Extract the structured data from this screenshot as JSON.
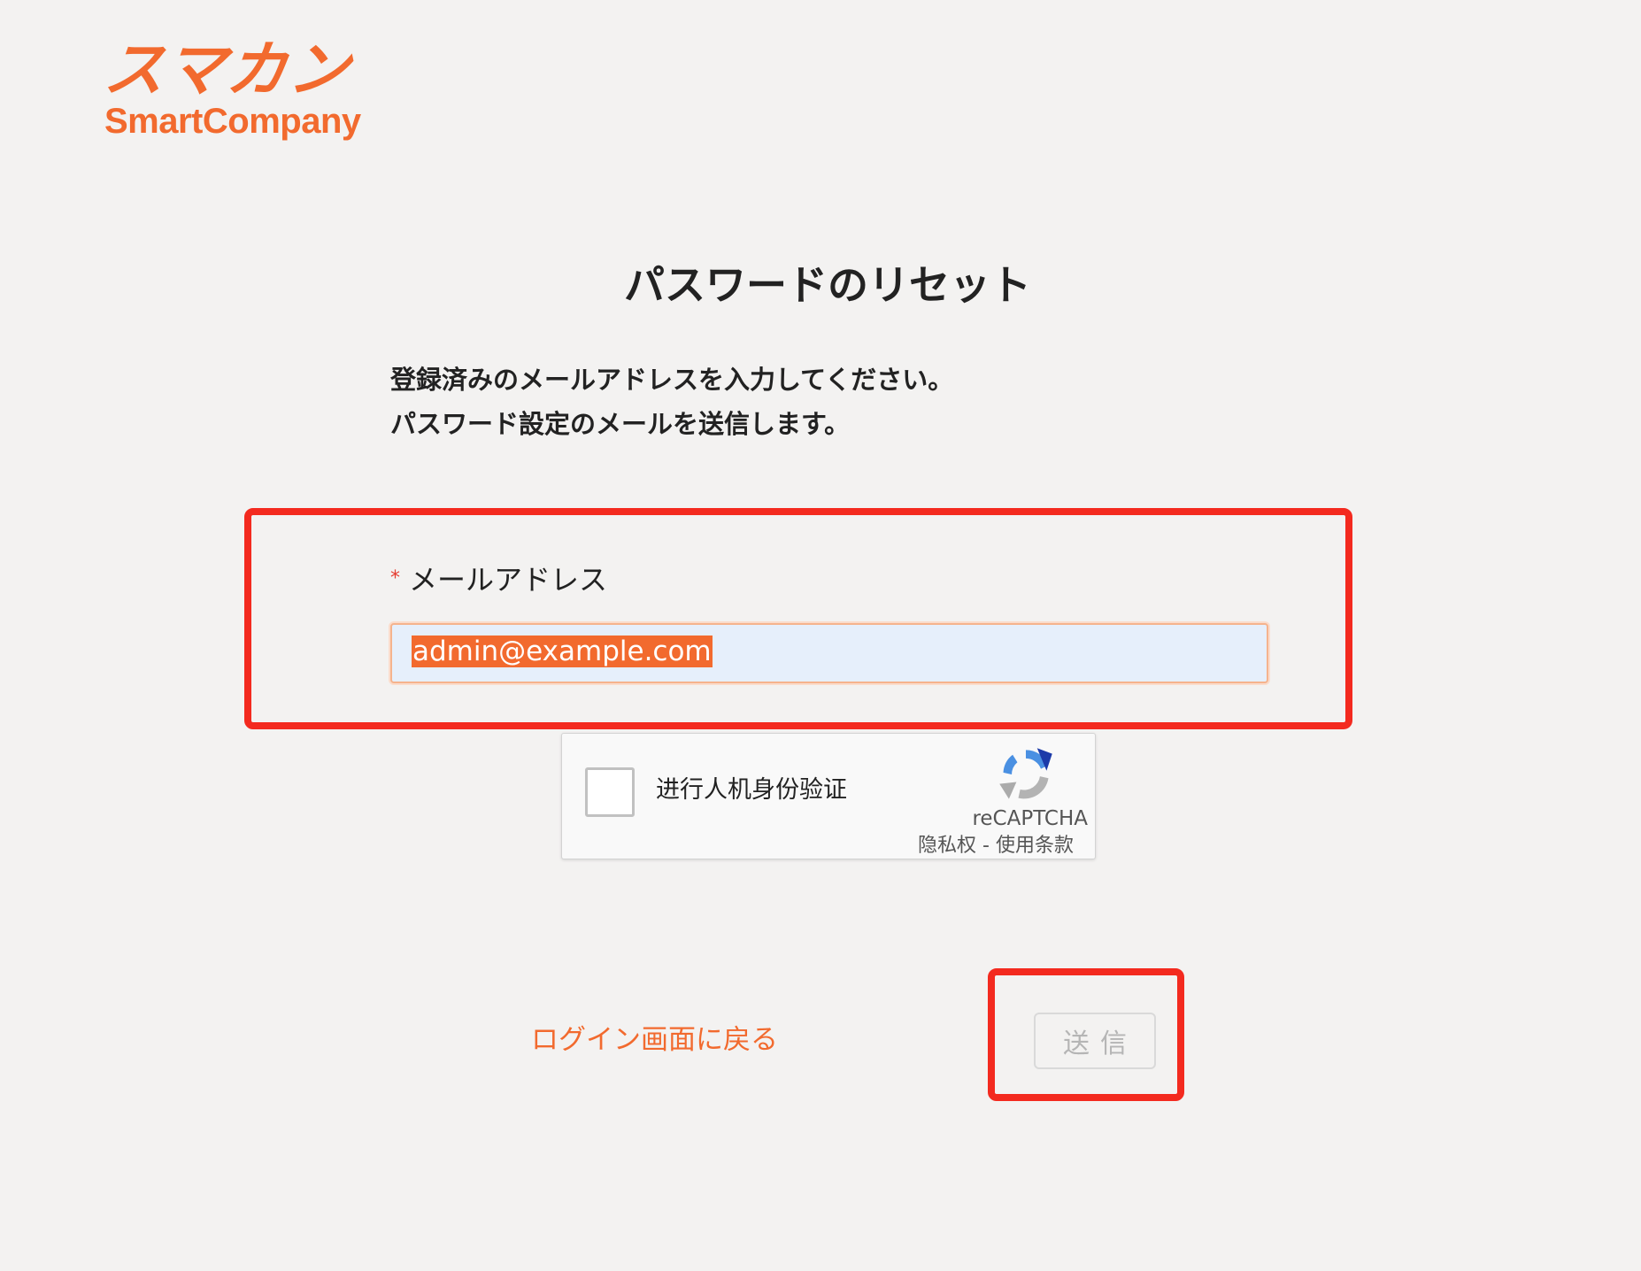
{
  "brand": {
    "logo_jp": "スマカン",
    "logo_en": "SmartCompany",
    "color": "#f26a2e"
  },
  "page": {
    "title": "パスワードのリセット",
    "description_line1": "登録済みのメールアドレスを入力してください。",
    "description_line2": "パスワード設定のメールを送信します。"
  },
  "form": {
    "email_label": "メールアドレス",
    "required_mark": "*",
    "email_value": "admin@example.com",
    "back_link_label": "ログイン画面に戻る",
    "submit_label": "送信",
    "submit_disabled": true
  },
  "recaptcha": {
    "checkbox_label": "进行人机身份验证",
    "brand": "reCAPTCHA",
    "privacy_label": "隐私权",
    "separator": " - ",
    "terms_label": "使用条款",
    "checked": false
  },
  "annotations": {
    "highlight_color": "#f32a1f"
  }
}
